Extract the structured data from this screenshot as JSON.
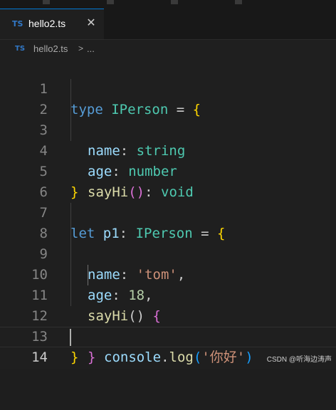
{
  "tab": {
    "badge": "TS",
    "label": "hello2.ts",
    "close": "✕"
  },
  "breadcrumb": {
    "badge": "TS",
    "file": "hello2.ts",
    "separator": ">",
    "more": "..."
  },
  "line_numbers": [
    "1",
    "2",
    "3",
    "4",
    "5",
    "6",
    "7",
    "8",
    "9",
    "10",
    "11",
    "12",
    "13",
    "14"
  ],
  "code": {
    "l1": {
      "kw": "type",
      "name": "IPerson",
      "eq": " = ",
      "open": "{"
    },
    "l2": {
      "prop": "name",
      "colon": ": ",
      "type": "string"
    },
    "l3": {
      "prop": "age",
      "colon": ": ",
      "type": "number"
    },
    "l4": {
      "fn": "sayHi",
      "open": "(",
      "close": ")",
      "colon": ": ",
      "type": "void"
    },
    "l5": {
      "close": "}"
    },
    "l7": {
      "kw": "let",
      "var": "p1",
      "colon": ": ",
      "type": "IPerson",
      "eq": " = ",
      "open": "{"
    },
    "l8": {
      "prop": "name",
      "colon": ": ",
      "value": "'tom'",
      "comma": ","
    },
    "l9": {
      "prop": "age",
      "colon": ": ",
      "value": "18",
      "comma": ","
    },
    "l10": {
      "fn": "sayHi",
      "paren": "()",
      "space": " ",
      "open": "{"
    },
    "l11": {
      "obj": "console",
      "dot": ".",
      "fn": "log",
      "open": "(",
      "value": "'你好'",
      "close": ")"
    },
    "l12": {
      "close": "}"
    },
    "l13": {
      "close": "}"
    }
  },
  "watermark": "CSDN @听海边涛声",
  "colors": {
    "keyword": "#569cd6",
    "type": "#4ec9b0",
    "property": "#9cdcfe",
    "function": "#dcdcaa",
    "string": "#ce9178",
    "number": "#b5cea8",
    "bracket_level1": "#ffd700",
    "bracket_level2": "#da70d6",
    "bracket_level3": "#179fff",
    "ts_badge": "#3178c6"
  }
}
